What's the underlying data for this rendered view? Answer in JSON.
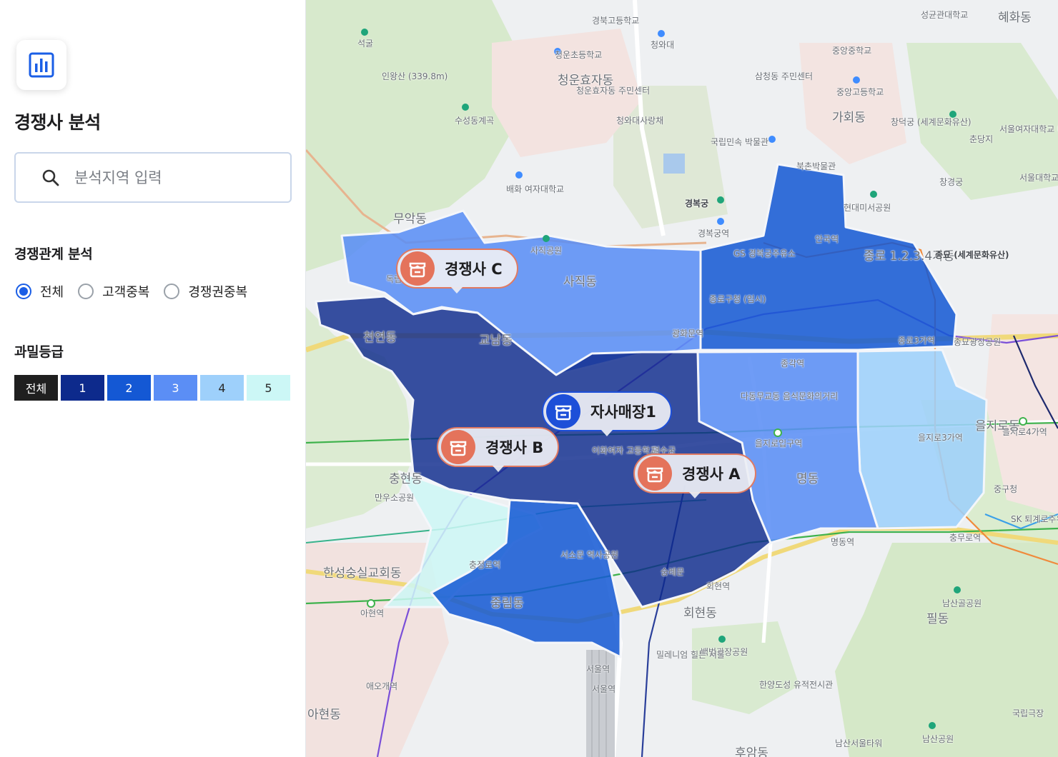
{
  "sidebar": {
    "title": "경쟁사 분석",
    "search_placeholder": "분석지역 입력",
    "relation_section": "경쟁관계 분석",
    "relation_options": [
      "전체",
      "고객중복",
      "경쟁권중복"
    ],
    "relation_selected": "전체",
    "grade_section": "과밀등급",
    "grades": [
      {
        "label": "전체",
        "color": "#1f1f1f",
        "text_color": "#ffffff"
      },
      {
        "label": "1",
        "color": "#0d2a8c",
        "text_color": "#ffffff"
      },
      {
        "label": "2",
        "color": "#1458d4",
        "text_color": "#ffffff"
      },
      {
        "label": "3",
        "color": "#5b8ef5",
        "text_color": "#ffffff"
      },
      {
        "label": "4",
        "color": "#9ed0fb",
        "text_color": "#2a2a2a"
      },
      {
        "label": "5",
        "color": "#ccf7f6",
        "text_color": "#2a2a2a"
      }
    ]
  },
  "map": {
    "markers": {
      "competitor_c": "경쟁사 C",
      "competitor_b": "경쟁사 B",
      "competitor_a": "경쟁사 A",
      "own_store": "자사매장1"
    },
    "labels": {
      "hyehwa": "혜화동",
      "sungkyun": "성균관대학교",
      "gyeongbok_hs": "경북고등학교",
      "cheongwadae": "청와대",
      "cheongun": "청운효자동",
      "cheongun_center": "청운효자동 주민센터",
      "cheongun_es": "청운초등학교",
      "samcheong": "삼청동 주민센터",
      "jungang_ms": "중앙중학교",
      "jungang_hs": "중앙고등학교",
      "gahoe": "가회동",
      "changdeok": "창덕궁 (세계문화유산)",
      "seoul_womens": "서울여자대학교 대학로캠퍼스",
      "snu_hospital": "서울대학교 병원",
      "changgyeong": "창경궁",
      "chundanji": "춘당지",
      "inwangsan": "인왕산 (339.8m)",
      "seokgul": "석굴",
      "suseong": "수성동계곡",
      "cheongwa_sarang": "청와대사랑채",
      "folk_museum": "국립민속 박물관",
      "bukchon": "북촌박물관",
      "baehwa": "배화 여자대학교",
      "gyeongbokgung": "경복궁",
      "hyundai": "현대미서공원",
      "jongmyo": "종묘 (세계문화유산)",
      "jongno_34": "종로 1.2.3.4가동",
      "anguk": "안국역",
      "muak": "무악동",
      "sajik": "사직공원",
      "sajikdong": "사직동",
      "gyeongbokgung_stn": "경복궁역",
      "dongnimmun": "독립문역",
      "gwanghwamun": "광화문역",
      "cheonyeon": "천연동",
      "gyonam": "교남동",
      "jongno3ga": "종로3가역",
      "jongmyo_park": "종묘광장공원",
      "jonggak": "종각역",
      "dadong": "다동무교동 음식문화의거리",
      "euljiro_stn": "을지로입구역",
      "euljiro3": "을지로3가역",
      "euljiro4": "을지로4가역",
      "euljirodong": "을지로동",
      "myeongdong": "명동",
      "myeongdong_stn": "명동역",
      "chunghyeon": "충현동",
      "manwoo": "만우소공원",
      "ahyeon": "아현역",
      "ahyeondong": "아현동",
      "chungjeongno": "충정로역",
      "jungnim": "중림동",
      "seosomun": "서소문 역사공원",
      "sungnyemun": "숭례문",
      "hoehyeon": "회현동",
      "hoehyeon_stn": "회현역",
      "seoul_stn": "서울역",
      "seoul_stn2": "서울역",
      "chungmuro": "충무로역",
      "pil": "필동",
      "namsan": "남산골공원",
      "namsan_tower": "남산서울타워",
      "namsan_park": "남산공원",
      "huam": "후암동",
      "baekbeom": "백범광장공원",
      "hanyang": "한양도성 유적전시관",
      "ewha": "이화여자 고등학교",
      "millennium": "밀레니엄 힐튼 서울",
      "aeogae": "애오개역",
      "national_theater": "국립극장",
      "toegyero": "SK 퇴계로주유소",
      "jung_office": "중구청",
      "sinchon": "한성숭실교회동",
      "gs": "GS 경복궁주유소",
      "jongno_office": "종로구청 (임시)",
      "deoksugung": "덕수궁"
    }
  }
}
